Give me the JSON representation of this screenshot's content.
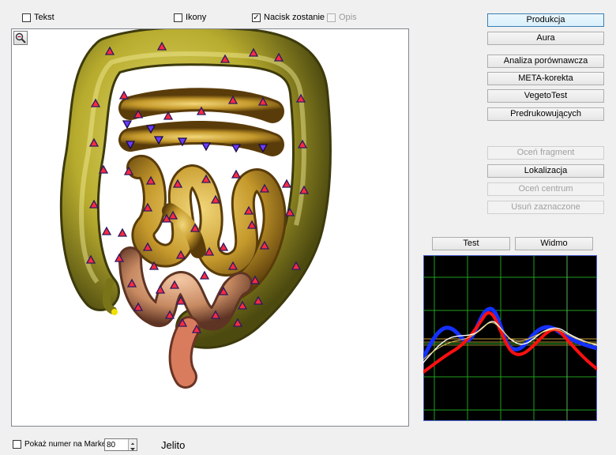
{
  "top_options": {
    "tekst": {
      "label": "Tekst",
      "checked": false
    },
    "ikony": {
      "label": "Ikony",
      "checked": false
    },
    "nacisk": {
      "label": "Nacisk zostanie p",
      "checked": true
    },
    "opis": {
      "label": "Opis",
      "checked": false,
      "disabled": true
    }
  },
  "side_buttons": {
    "produkcja": "Produkcja",
    "aura": "Aura",
    "analiza": "Analiza porównawcza",
    "meta": "META-korekta",
    "vegeto": "VegetoTest",
    "predruk": "Predrukowujących",
    "ocen_fragment": "Oceń fragment",
    "lokalizacja": "Lokalizacja",
    "ocen_centrum": "Oceń centrum",
    "usun": "Usuń zaznaczone"
  },
  "graph_buttons": {
    "test": "Test",
    "widmo": "Widmo"
  },
  "bottom": {
    "show_marker_label": "Pokaż numer na Marker",
    "show_marker_checked": false,
    "spin_value": "80",
    "organ_name": "Jelito"
  },
  "colors": {
    "graph_bg": "#000000",
    "grid": "#1fa01f",
    "curve_blue": "#1430ff",
    "curve_red": "#ff1010",
    "curve_white": "#ffffff",
    "curve_yellow": "#e0c060",
    "marker_red": "#ff2a40",
    "marker_blue": "#6a3cff"
  },
  "icons": {
    "zoom": "magnifier-icon",
    "up": "spin-up-icon",
    "down": "spin-down-icon"
  }
}
